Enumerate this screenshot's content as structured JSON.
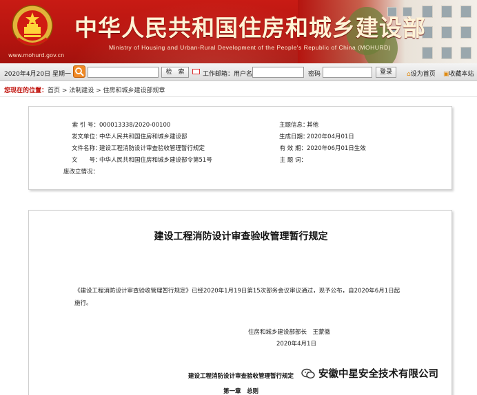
{
  "banner": {
    "title_cn": "中华人民共和国住房和城乡建设部",
    "title_en": "Ministry of Housing and Urban-Rural Development of the People's Republic of China (MOHURD)",
    "site_url": "www.mohurd.gov.cn",
    "emblem": "national-emblem"
  },
  "toolbar": {
    "date": "2020年4月20日 星期一",
    "search_value": "",
    "search_button": "检　索",
    "mail_label": "工作邮箱：用户名",
    "username_value": "",
    "password_label": "密码",
    "password_value": "",
    "login_button": "登录",
    "set_home": "设为首页",
    "bookmark": "收藏本站"
  },
  "breadcrumb": {
    "lead": "您现在的位置：",
    "path": "首页 > 法制建设 > 住房和城乡建设部规章"
  },
  "info": {
    "index_key": "索 引 号：",
    "index_val": "000013338/2020-00100",
    "issuer_key": "发文单位：",
    "issuer_val": "中华人民共和国住房和城乡建设部",
    "docname_key": "文件名称：",
    "docname_val": "建设工程消防设计审查验收管理暂行规定",
    "docno_key": "文　　号：",
    "docno_val": "中华人民共和国住房和城乡建设部令第51号",
    "status_key": "废改立情况：",
    "status_val": "",
    "topic_key": "主题信息：",
    "topic_val": "其他",
    "created_key": "生成日期：",
    "created_val": "2020年04月01日",
    "valid_key": "有 效 期：",
    "valid_val": "2020年06月01日生效",
    "keywords_key": "主 题 词：",
    "keywords_val": ""
  },
  "document": {
    "title": "建设工程消防设计审查验收管理暂行规定",
    "body": "《建设工程消防设计审查验收管理暂行规定》已经2020年1月19日第15次部务会议审议通过，现予公布，自2020年6月1日起施行。",
    "signature": "住房和城乡建设部部长　王蒙徽",
    "date": "2020年4月1日",
    "subtitle": "建设工程消防设计审查验收管理暂行规定",
    "chapter": "第一章　总则"
  },
  "watermark": {
    "text": "安徽中星安全技术有限公司",
    "icon": "wechat-icon"
  },
  "colors": {
    "banner_red": "#b5140f",
    "crumb_red": "#c0110b",
    "search_orange": "#f08a26"
  }
}
